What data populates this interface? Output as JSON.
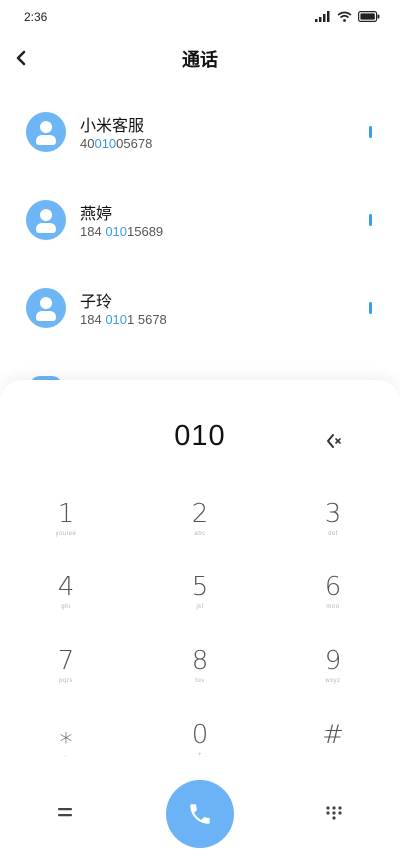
{
  "status_bar": {
    "time": "2:36"
  },
  "header": {
    "title": "通话"
  },
  "contacts": [
    {
      "name": "小米客服",
      "number_pre": "40",
      "number_match": "010",
      "number_post": "05678"
    },
    {
      "name": "燕婷",
      "number_pre": "184 ",
      "number_match": "010",
      "number_post": "15689"
    },
    {
      "name": "子玲",
      "number_pre": "184 ",
      "number_match": "010",
      "number_post": "1 5678"
    }
  ],
  "dialer": {
    "input": "010",
    "keys": [
      {
        "digit": "1",
        "letters": "youlee"
      },
      {
        "digit": "2",
        "letters": "abc"
      },
      {
        "digit": "3",
        "letters": "def"
      },
      {
        "digit": "4",
        "letters": "ghi"
      },
      {
        "digit": "5",
        "letters": "jkl"
      },
      {
        "digit": "6",
        "letters": "mno"
      },
      {
        "digit": "7",
        "letters": "pqrs"
      },
      {
        "digit": "8",
        "letters": "tuv"
      },
      {
        "digit": "9",
        "letters": "wxyz"
      },
      {
        "digit": "⁎",
        "letters": ","
      },
      {
        "digit": "0",
        "letters": "+"
      },
      {
        "digit": "#",
        "letters": ""
      }
    ]
  },
  "colors": {
    "accent": "#3a9be8",
    "avatar": "#6db5f4",
    "call_button": "#6cb2f7"
  },
  "icons": [
    "back-arrow-icon",
    "signal-icon",
    "wifi-icon",
    "battery-icon",
    "person-icon",
    "backspace-icon",
    "menu-icon",
    "phone-icon",
    "dialpad-icon"
  ]
}
